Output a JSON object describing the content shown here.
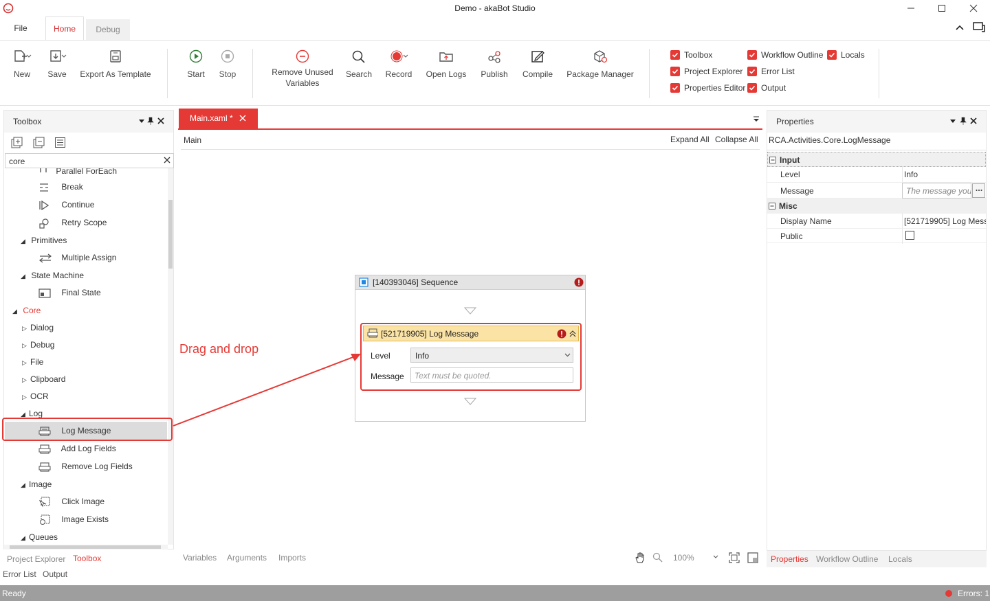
{
  "window": {
    "title": "Demo - akaBot Studio"
  },
  "menu_tabs": {
    "file": "File",
    "home": "Home",
    "debug": "Debug"
  },
  "ribbon": {
    "new": "New",
    "save": "Save",
    "export_template": "Export As Template",
    "start": "Start",
    "stop": "Stop",
    "remove_unused_line1": "Remove Unused",
    "remove_unused_line2": "Variables",
    "search": "Search",
    "record": "Record",
    "open_logs": "Open Logs",
    "publish": "Publish",
    "compile": "Compile",
    "package_manager": "Package Manager",
    "toggles": {
      "toolbox": "Toolbox",
      "project_explorer": "Project Explorer",
      "properties_editor": "Properties Editor",
      "workflow_outline": "Workflow Outline",
      "error_list": "Error List",
      "output": "Output",
      "locals": "Locals"
    }
  },
  "toolbox": {
    "title": "Toolbox",
    "search_value": "core",
    "items": {
      "parallel_foreach": "Parallel ForEach",
      "break": "Break",
      "continue": "Continue",
      "retry_scope": "Retry Scope",
      "primitives": "Primitives",
      "multiple_assign": "Multiple Assign",
      "state_machine": "State Machine",
      "final_state": "Final State",
      "core": "Core",
      "dialog": "Dialog",
      "debug": "Debug",
      "file": "File",
      "clipboard": "Clipboard",
      "ocr": "OCR",
      "log": "Log",
      "log_message": "Log Message",
      "add_log_fields": "Add Log Fields",
      "remove_log_fields": "Remove Log Fields",
      "image": "Image",
      "click_image": "Click Image",
      "image_exists": "Image Exists",
      "queues": "Queues"
    }
  },
  "left_bottom_tabs": {
    "project_explorer": "Project Explorer",
    "toolbox": "Toolbox",
    "error_list": "Error List",
    "output": "Output"
  },
  "designer": {
    "tab_label": "Main.xaml *",
    "breadcrumb": "Main",
    "expand_all": "Expand All",
    "collapse_all": "Collapse All",
    "annotation": "Drag and drop",
    "sequence_title": "[140393046] Sequence",
    "log_title": "[521719905] Log Message",
    "level_label": "Level",
    "level_value": "Info",
    "message_label": "Message",
    "message_placeholder": "Text must be quoted.",
    "bottom_tabs": {
      "variables": "Variables",
      "arguments": "Arguments",
      "imports": "Imports"
    },
    "zoom": "100%"
  },
  "properties": {
    "title": "Properties",
    "class_name": "RCA.Activities.Core.LogMessage",
    "input_category": "Input",
    "level_label": "Level",
    "level_value": "Info",
    "message_label": "Message",
    "message_placeholder": "The message you",
    "misc_category": "Misc",
    "display_name_label": "Display Name",
    "display_name_value": "[521719905] Log Mess",
    "public_label": "Public",
    "bottom_tabs": {
      "properties": "Properties",
      "workflow_outline": "Workflow Outline",
      "locals": "Locals"
    }
  },
  "status": {
    "text": "Ready",
    "errors": "Errors: 1"
  },
  "colors": {
    "accent": "#e53935",
    "status_bar": "#9e9e9e"
  }
}
